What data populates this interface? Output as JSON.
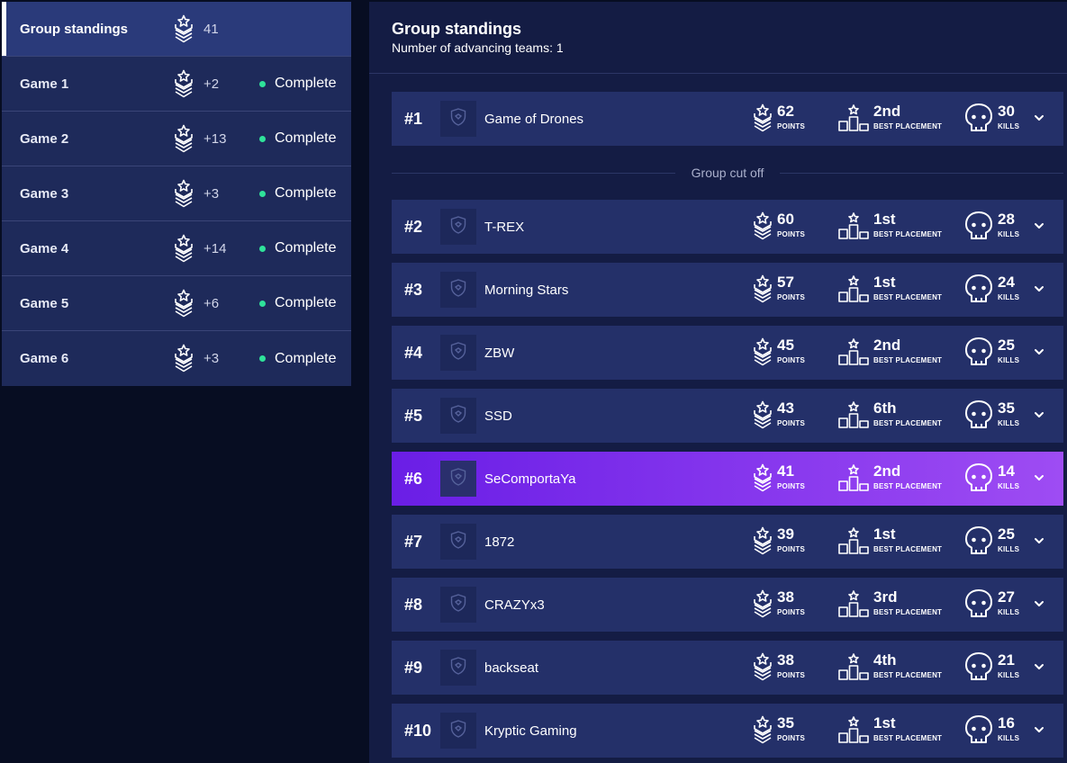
{
  "sidebar": {
    "items": [
      {
        "label": "Group standings",
        "points": "41",
        "status": "",
        "active": true
      },
      {
        "label": "Game 1",
        "points": "+2",
        "status": "Complete"
      },
      {
        "label": "Game 2",
        "points": "+13",
        "status": "Complete"
      },
      {
        "label": "Game 3",
        "points": "+3",
        "status": "Complete"
      },
      {
        "label": "Game 4",
        "points": "+14",
        "status": "Complete"
      },
      {
        "label": "Game 5",
        "points": "+6",
        "status": "Complete"
      },
      {
        "label": "Game 6",
        "points": "+3",
        "status": "Complete"
      }
    ]
  },
  "panel": {
    "title": "Group standings",
    "subtitle": "Number of advancing teams: 1",
    "cutoff_label": "Group cut off",
    "labels": {
      "points": "POINTS",
      "best_placement": "BEST PLACEMENT",
      "kills": "KILLS"
    }
  },
  "teams": [
    {
      "rank": "#1",
      "name": "Game of Drones",
      "points": "62",
      "placement": "2nd",
      "kills": "30"
    },
    {
      "rank": "#2",
      "name": "T-REX",
      "points": "60",
      "placement": "1st",
      "kills": "28"
    },
    {
      "rank": "#3",
      "name": "Morning Stars",
      "points": "57",
      "placement": "1st",
      "kills": "24"
    },
    {
      "rank": "#4",
      "name": "ZBW",
      "points": "45",
      "placement": "2nd",
      "kills": "25"
    },
    {
      "rank": "#5",
      "name": "SSD",
      "points": "43",
      "placement": "6th",
      "kills": "35"
    },
    {
      "rank": "#6",
      "name": "SeComportaYa",
      "points": "41",
      "placement": "2nd",
      "kills": "14",
      "highlight": true
    },
    {
      "rank": "#7",
      "name": "1872",
      "points": "39",
      "placement": "1st",
      "kills": "25"
    },
    {
      "rank": "#8",
      "name": "CRAZYx3",
      "points": "38",
      "placement": "3rd",
      "kills": "27"
    },
    {
      "rank": "#9",
      "name": "backseat",
      "points": "38",
      "placement": "4th",
      "kills": "21"
    },
    {
      "rank": "#10",
      "name": "Kryptic Gaming",
      "points": "35",
      "placement": "1st",
      "kills": "16"
    }
  ],
  "colors": {
    "status_complete": "#2fe29a",
    "highlight_start": "#6a1ee6",
    "highlight_end": "#9e4cf3"
  },
  "icons": {
    "points": "chevron-star-icon",
    "placement": "podium-icon",
    "kills": "skull-icon",
    "logo": "shield-icon",
    "expand": "chevron-down-icon"
  }
}
